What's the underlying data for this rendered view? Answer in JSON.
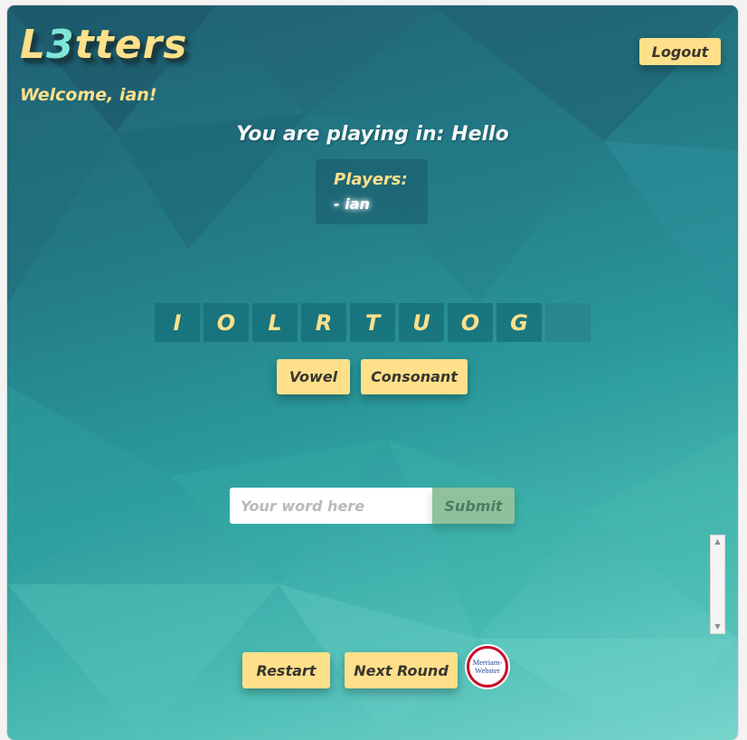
{
  "app": {
    "title_prefix": "L",
    "title_accent": "3",
    "title_suffix": "tters",
    "welcome": "Welcome, ian!"
  },
  "header": {
    "logout_label": "Logout"
  },
  "room": {
    "playing_in": "You are playing in: Hello",
    "players_label": "Players:",
    "players": [
      "- ian"
    ]
  },
  "tiles": [
    "I",
    "O",
    "L",
    "R",
    "T",
    "U",
    "O",
    "G",
    ""
  ],
  "letter_buttons": {
    "vowel": "Vowel",
    "consonant": "Consonant"
  },
  "word_form": {
    "placeholder": "Your word here",
    "submit_label": "Submit"
  },
  "controls": {
    "restart": "Restart",
    "next_round": "Next Round"
  },
  "dictionary_logo": {
    "line1": "Merriam-",
    "line2": "Webster"
  },
  "icons": {
    "scroll_up": "scroll-up-arrow-icon",
    "scroll_down": "scroll-down-arrow-icon"
  },
  "colors": {
    "accent_yellow": "#ffe08a",
    "submit_green": "#8fc29c",
    "logo_red": "#c8102e"
  }
}
